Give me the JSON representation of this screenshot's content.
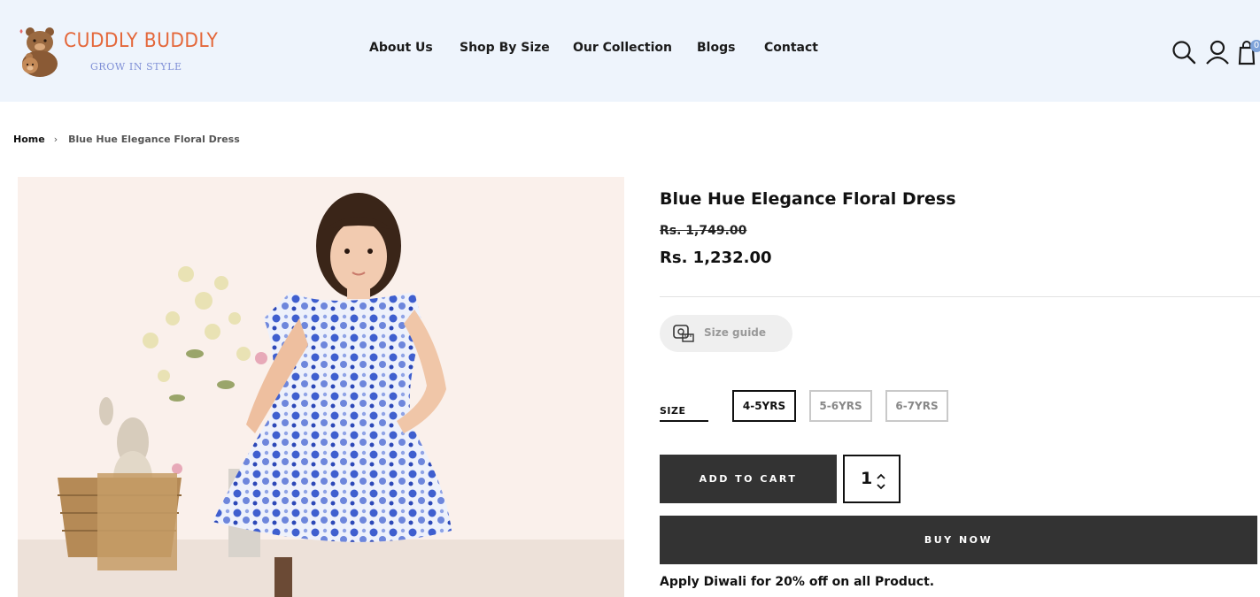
{
  "header": {
    "logo": {
      "title": "CUDDLY BUDDLY",
      "tagline": "GROW IN STYLE",
      "icon": "bear-family-logo"
    },
    "nav": [
      "About Us",
      "Shop By Size",
      "Our Collection",
      "Blogs",
      "Contact"
    ],
    "icons": [
      "search-icon",
      "account-icon",
      "cart-icon"
    ],
    "cart_count": "0"
  },
  "breadcrumb": {
    "home": "Home",
    "separator": "›",
    "current": "Blue Hue Elegance Floral Dress"
  },
  "product": {
    "title": "Blue Hue Elegance Floral Dress",
    "price_original": "Rs. 1,749.00",
    "price_sale": "Rs. 1,232.00",
    "size_guide_label": "Size guide",
    "size_label": "SIZE",
    "sizes": [
      "4-5YRS",
      "5-6YRS",
      "6-7YRS"
    ],
    "selected_size": "4-5YRS",
    "quantity": "1",
    "add_to_cart_label": "ADD TO CART",
    "buy_now_label": "BUY NOW",
    "promo": "Apply Diwali for 20% off on all Product."
  },
  "colors": {
    "header_bg": "#eef4fc",
    "brand_orange": "#e4673a",
    "brand_blue": "#7f8fd6",
    "button_dark": "#333333",
    "dress_blue": "#3f5fcf"
  }
}
